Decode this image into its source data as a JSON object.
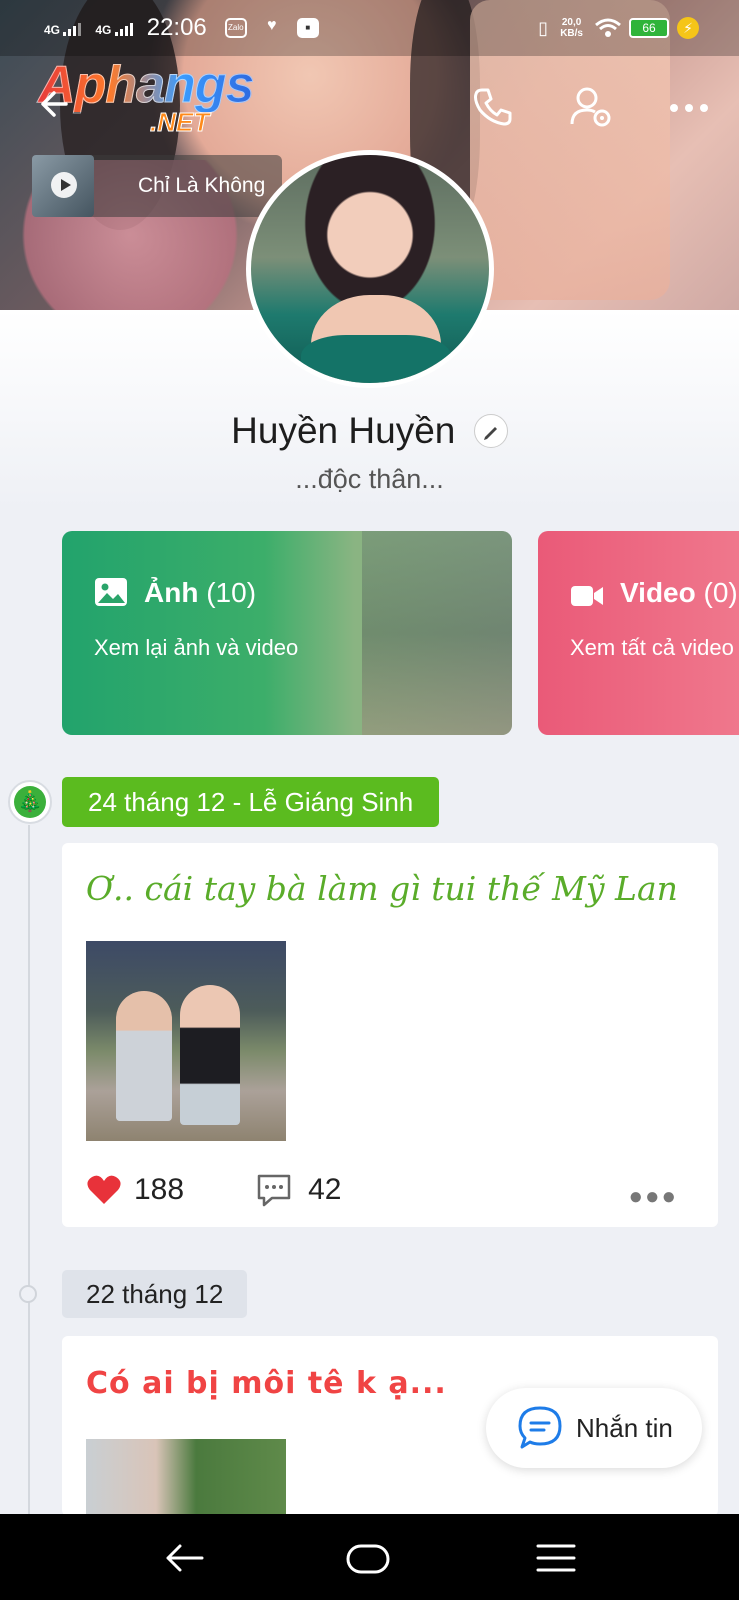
{
  "status_bar": {
    "net1": "4G",
    "net2": "4G",
    "time": "22:06",
    "app1": "Zalo",
    "speed_value": "20,0",
    "speed_unit": "KB/s",
    "battery": "66"
  },
  "watermark": {
    "line1": "Aphangs",
    "line2": ".NET"
  },
  "music": {
    "title": "Chỉ Là Không"
  },
  "profile": {
    "name": "Huyền Huyền",
    "status": "...độc thân..."
  },
  "media": {
    "photo": {
      "label": "Ảnh",
      "count": "(10)",
      "subtitle": "Xem lại ảnh và video"
    },
    "video": {
      "label": "Video",
      "count": "(0)",
      "subtitle": "Xem tất cả video"
    }
  },
  "timeline": [
    {
      "date": "24 tháng 12 - Lễ Giáng Sinh",
      "post_text": "Ơ.. cái tay bà làm gì tui thế Mỹ Lan",
      "likes": "188",
      "comments": "42"
    },
    {
      "date": "22 tháng 12",
      "post_text": "Có ai bị môi tê k ạ..."
    }
  ],
  "message_button": {
    "label": "Nhắn tin"
  },
  "colors": {
    "photo_card": "#22a36c",
    "video_card": "#ea5a78",
    "date_badge": "#5bbb1f",
    "post_title_green": "#5aac2a",
    "post_title_red": "#f04444",
    "like_red": "#e8323a"
  },
  "icons": {
    "back": "arrow-left-icon",
    "call": "phone-icon",
    "settings": "user-settings-icon",
    "more": "more-horizontal-icon",
    "photo": "image-icon",
    "video": "video-camera-icon",
    "like": "heart-icon",
    "comment": "comment-icon",
    "message": "chat-bubble-icon"
  }
}
